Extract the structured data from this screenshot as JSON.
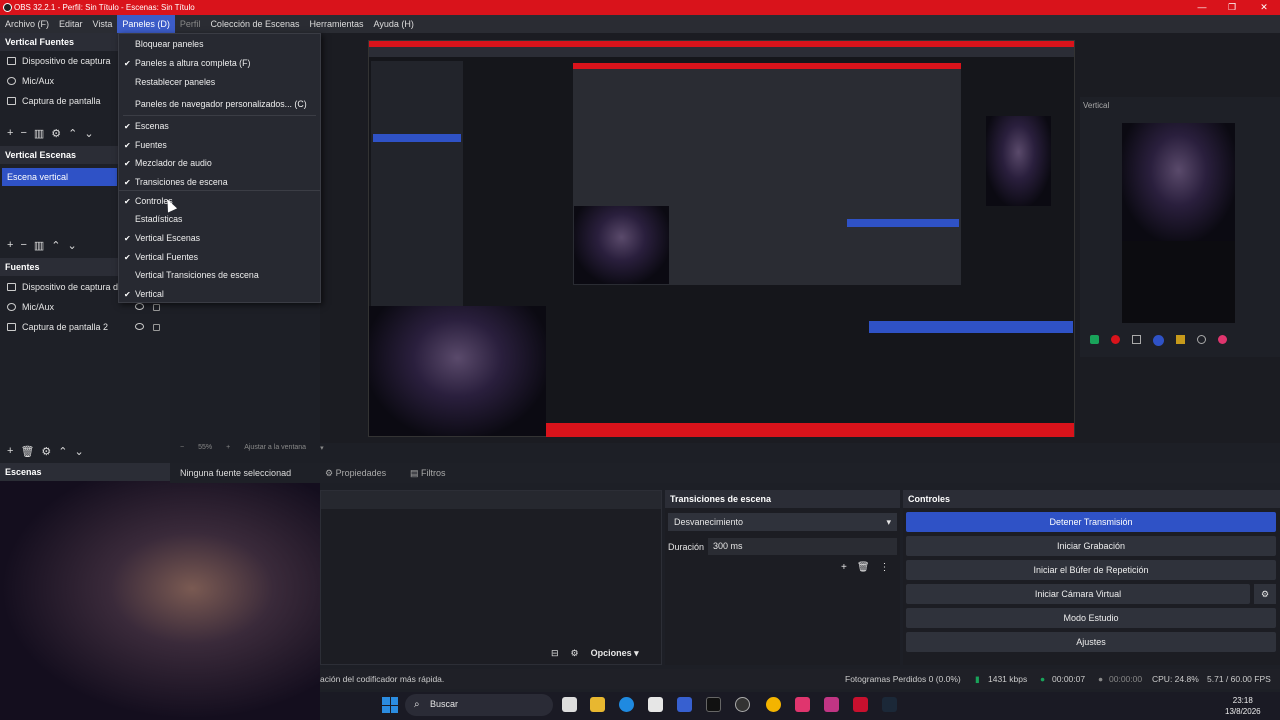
{
  "window": {
    "title": "OBS 32.2.1 - Perfil: Sin Título - Escenas: Sin Título"
  },
  "menubar": [
    {
      "label": "Archivo (F)"
    },
    {
      "label": "Editar"
    },
    {
      "label": "Vista"
    },
    {
      "label": "Paneles (D)"
    },
    {
      "label": "Perfil"
    },
    {
      "label": "Colección de Escenas"
    },
    {
      "label": "Herramientas"
    },
    {
      "label": "Ayuda (H)"
    }
  ],
  "panels_menu": [
    {
      "label": "Bloquear paneles",
      "checked": false
    },
    {
      "label": "Paneles a altura completa (F)",
      "checked": true
    },
    {
      "label": "Restablecer paneles",
      "checked": false
    },
    {
      "label": "Paneles de navegador personalizados... (C)",
      "checked": false
    },
    {
      "label": "Escenas",
      "checked": true
    },
    {
      "label": "Fuentes",
      "checked": true
    },
    {
      "label": "Mezclador de audio",
      "checked": true
    },
    {
      "label": "Transiciones de escena",
      "checked": true
    },
    {
      "label": "Controles",
      "checked": true
    },
    {
      "label": "Estadísticas",
      "checked": false
    },
    {
      "label": "Vertical Escenas",
      "checked": true
    },
    {
      "label": "Vertical Fuentes",
      "checked": true
    },
    {
      "label": "Vertical Transiciones de escena",
      "checked": false
    },
    {
      "label": "Vertical",
      "checked": true
    }
  ],
  "vertical_fuentes": {
    "title": "Vertical Fuentes",
    "items": [
      "Dispositivo de captura",
      "Mic/Aux",
      "Captura de pantalla"
    ]
  },
  "vertical_escenas": {
    "title": "Vertical Escenas",
    "items": [
      "Escena vertical"
    ]
  },
  "fuentes": {
    "title": "Fuentes",
    "items": [
      "Dispositivo de captura d",
      "Mic/Aux",
      "Captura de pantalla 2"
    ]
  },
  "escenas": {
    "title": "Escenas"
  },
  "preview_toolbar": {
    "zoom": "55%",
    "fit": "Ajustar a la ventana"
  },
  "source_bar": {
    "no_source": "Ninguna fuente seleccionad",
    "properties": "Propiedades",
    "filters": "Filtros"
  },
  "transiciones": {
    "title": "Transiciones de escena",
    "selected": "Desvanecimiento",
    "duration_label": "Duración",
    "duration_value": "300 ms"
  },
  "controles": {
    "title": "Controles",
    "buttons": [
      "Detener Transmisión",
      "Iniciar Grabación",
      "Iniciar el Búfer de Repetición",
      "Iniciar Cámara Virtual",
      "Modo Estudio",
      "Ajustes"
    ]
  },
  "options_label": "Opciones",
  "vertical_label": "Vertical",
  "statusbar": {
    "message": "ación del codificador más rápida.",
    "dropped": "Fotogramas Perdidos 0 (0.0%)",
    "bitrate": "1431 kbps",
    "stream_time": "00:00:07",
    "rec_time": "00:00:00",
    "cpu": "CPU: 24.8%",
    "fps": "5.71 / 60.00 FPS"
  },
  "taskbar": {
    "search": "Buscar",
    "time": "23:18",
    "date": "13/8/2026"
  },
  "colors": {
    "accent": "#2f52c6",
    "title_red": "#d9131b"
  }
}
